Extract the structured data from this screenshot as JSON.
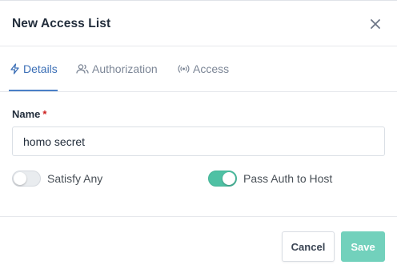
{
  "modal": {
    "title": "New Access List",
    "close_icon": "close-icon"
  },
  "tabs": [
    {
      "label": "Details",
      "icon": "zap-icon",
      "active": true
    },
    {
      "label": "Authorization",
      "icon": "users-icon",
      "active": false
    },
    {
      "label": "Access",
      "icon": "radio-icon",
      "active": false
    }
  ],
  "form": {
    "name_label": "Name",
    "required_marker": "*",
    "name_value": "homo secret",
    "satisfy_any": {
      "label": "Satisfy Any",
      "checked": false
    },
    "pass_auth": {
      "label": "Pass Auth to Host",
      "checked": true
    }
  },
  "footer": {
    "cancel_label": "Cancel",
    "save_label": "Save"
  },
  "colors": {
    "accent": "#3b6fb6",
    "toggle_on": "#4fc1a4",
    "save_button": "#72d1bc",
    "required": "#cd201f"
  }
}
